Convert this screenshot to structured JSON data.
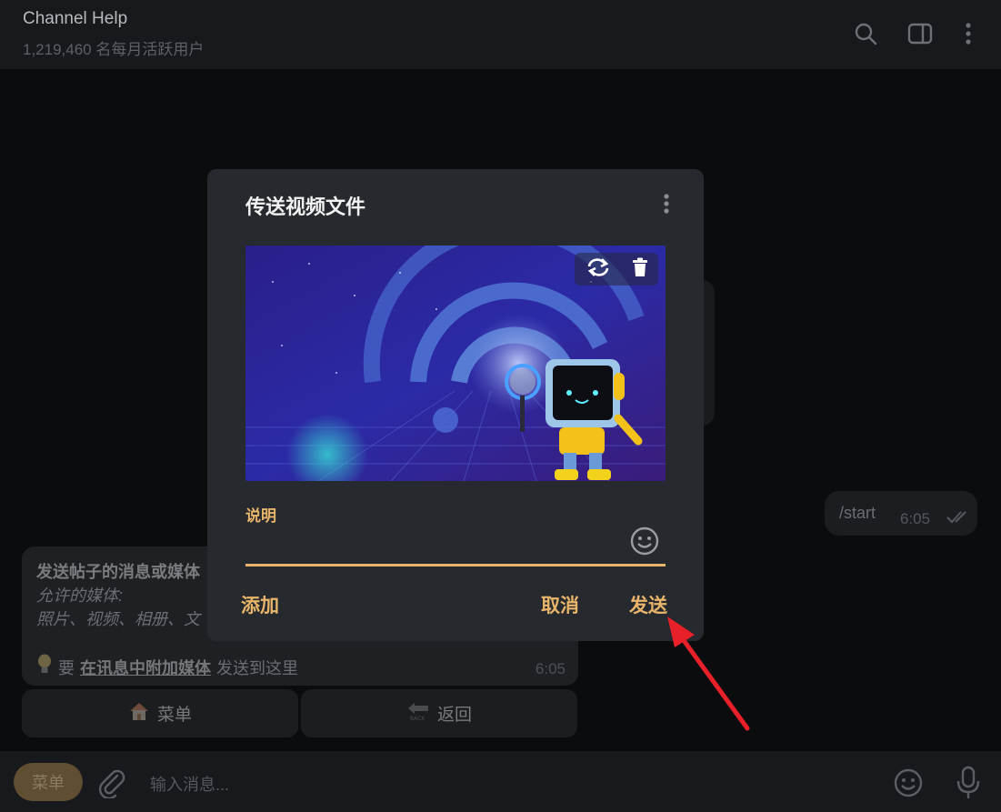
{
  "header": {
    "title": "Channel Help",
    "subtitle": "1,219,460 名每月活跃用户",
    "icons": [
      "search-icon",
      "sidebar-toggle-icon",
      "more-vertical-icon"
    ]
  },
  "chat": {
    "outgoing": {
      "text": "/start",
      "time": "6:05"
    },
    "incoming": {
      "line1": "发送帖子的消息或媒体",
      "line2": "允许的媒体:",
      "line3": "照片、视频、相册、文",
      "hint_prefix": "要",
      "hint_link": "在讯息中附加媒体",
      "hint_suffix": "发送到这里",
      "time": "6:05"
    },
    "keyboard": [
      {
        "icon": "house-emoji",
        "label": "菜单"
      },
      {
        "icon": "back-arrow-emoji",
        "label": "返回"
      }
    ]
  },
  "input": {
    "menu_label": "菜单",
    "placeholder": "输入消息..."
  },
  "dialog": {
    "title": "传送视频文件",
    "caption_label": "说明",
    "caption_value": "",
    "add_label": "添加",
    "cancel_label": "取消",
    "send_label": "发送"
  },
  "colors": {
    "accent": "#e8b56a",
    "dialog_bg": "#26292d",
    "arrow": "#e8202a"
  }
}
